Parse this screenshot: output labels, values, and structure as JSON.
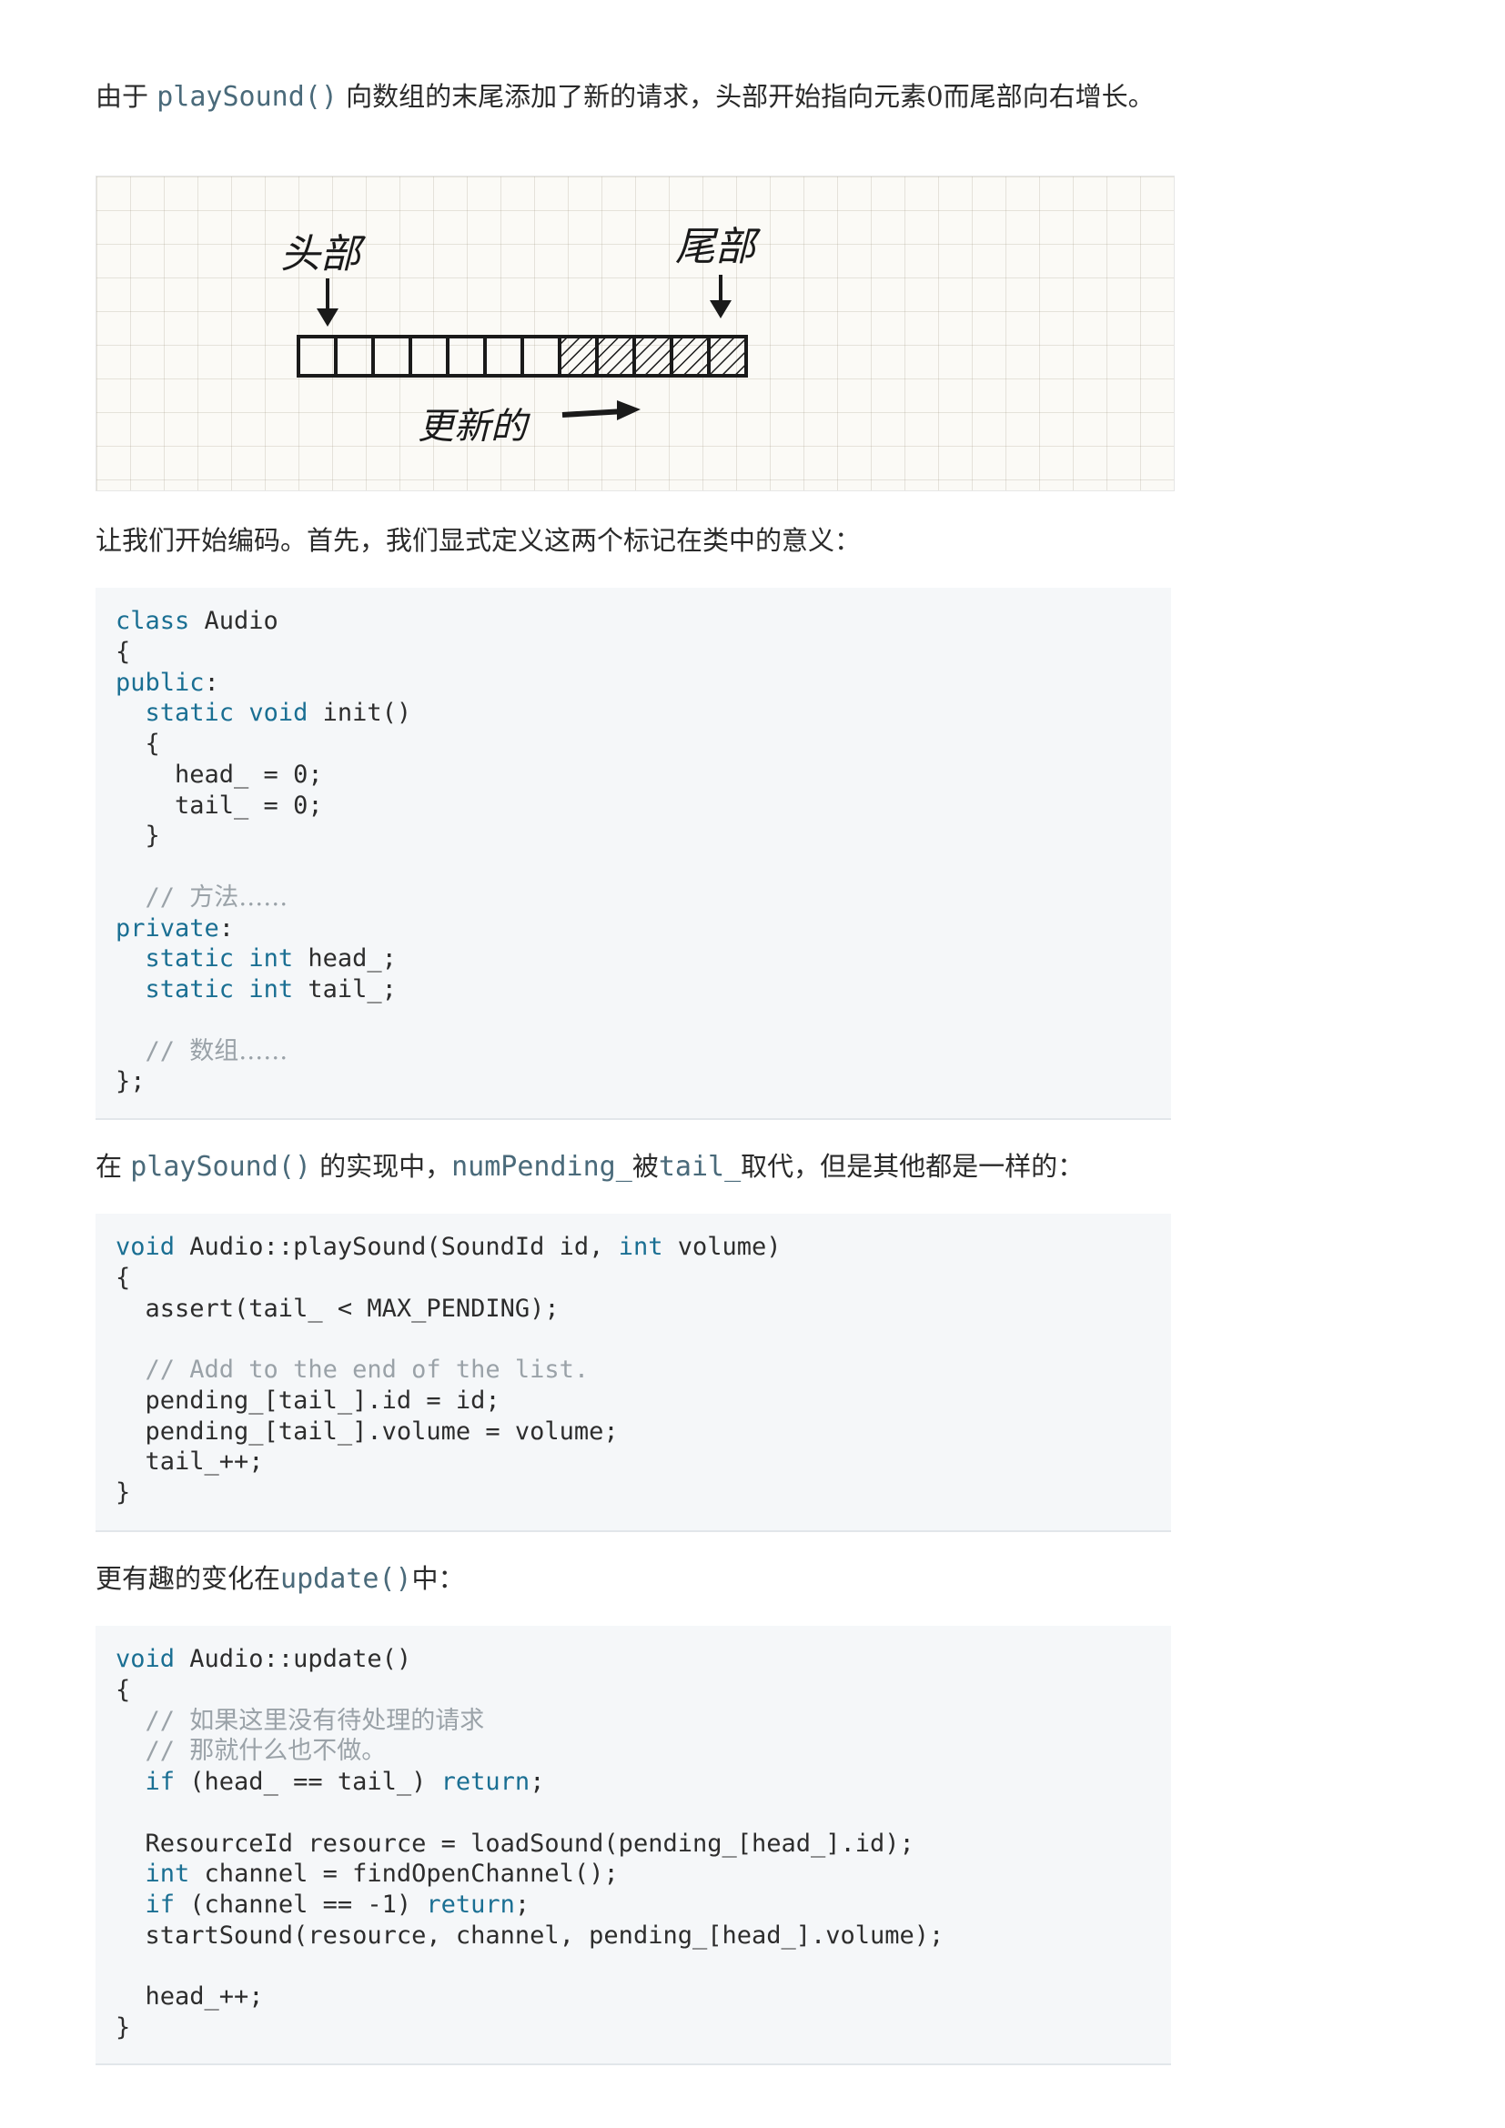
{
  "paragraphs": {
    "p1": [
      {
        "t": "由于 ",
        "k": "text"
      },
      {
        "t": "playSound()",
        "k": "code"
      },
      {
        "t": " 向数组的末尾添加了新的请求，头部开始指向元素0而尾部向右增长。",
        "k": "text"
      }
    ],
    "p2": [
      {
        "t": "让我们开始编码。首先，我们显式定义这两个标记在类中的意义：",
        "k": "text"
      }
    ],
    "p3": [
      {
        "t": "在 ",
        "k": "text"
      },
      {
        "t": "playSound()",
        "k": "code"
      },
      {
        "t": " 的实现中，",
        "k": "text"
      },
      {
        "t": "numPending_",
        "k": "code"
      },
      {
        "t": "被",
        "k": "text"
      },
      {
        "t": "tail_",
        "k": "code"
      },
      {
        "t": "取代，但是其他都是一样的：",
        "k": "text"
      }
    ],
    "p4": [
      {
        "t": "更有趣的变化在",
        "k": "text"
      },
      {
        "t": "update()",
        "k": "code"
      },
      {
        "t": "中：",
        "k": "text"
      }
    ]
  },
  "figure": {
    "head_label": "头部",
    "tail_label": "尾部",
    "newer_label": "更新的",
    "cell_count": 12,
    "empty_cells": 7,
    "filled_cells": 5
  },
  "code_blocks": {
    "audio_class": [
      [
        [
          "class",
          "kw"
        ],
        [
          " Audio",
          ""
        ]
      ],
      [
        [
          "{",
          ""
        ]
      ],
      [
        [
          "public",
          "kw"
        ],
        [
          ":",
          ""
        ]
      ],
      [
        [
          "  ",
          ""
        ],
        [
          "static",
          "kw"
        ],
        [
          " ",
          ""
        ],
        [
          "void",
          "kw"
        ],
        [
          " init()",
          ""
        ]
      ],
      [
        [
          "  {",
          ""
        ]
      ],
      [
        [
          "    head_ = 0;",
          ""
        ]
      ],
      [
        [
          "    tail_ = 0;",
          ""
        ]
      ],
      [
        [
          "  }",
          ""
        ]
      ],
      [
        [
          "",
          ""
        ]
      ],
      [
        [
          "  ",
          ""
        ],
        [
          "// ",
          "cm"
        ],
        [
          "方法……",
          "cmcn"
        ]
      ],
      [
        [
          "private",
          "kw"
        ],
        [
          ":",
          ""
        ]
      ],
      [
        [
          "  ",
          ""
        ],
        [
          "static",
          "kw"
        ],
        [
          " ",
          ""
        ],
        [
          "int",
          "kw"
        ],
        [
          " head_;",
          ""
        ]
      ],
      [
        [
          "  ",
          ""
        ],
        [
          "static",
          "kw"
        ],
        [
          " ",
          ""
        ],
        [
          "int",
          "kw"
        ],
        [
          " tail_;",
          ""
        ]
      ],
      [
        [
          "",
          ""
        ]
      ],
      [
        [
          "  ",
          ""
        ],
        [
          "// ",
          "cm"
        ],
        [
          "数组……",
          "cmcn"
        ]
      ],
      [
        [
          "};",
          ""
        ]
      ]
    ],
    "play_sound": [
      [
        [
          "void",
          "kw"
        ],
        [
          " Audio::playSound(SoundId id, ",
          ""
        ],
        [
          "int",
          "kw"
        ],
        [
          " volume)",
          ""
        ]
      ],
      [
        [
          "{",
          ""
        ]
      ],
      [
        [
          "  assert(tail_ < MAX_PENDING);",
          ""
        ]
      ],
      [
        [
          "",
          ""
        ]
      ],
      [
        [
          "  ",
          ""
        ],
        [
          "// Add to the end of the list.",
          "cm"
        ]
      ],
      [
        [
          "  pending_[tail_].id = id;",
          ""
        ]
      ],
      [
        [
          "  pending_[tail_].volume = volume;",
          ""
        ]
      ],
      [
        [
          "  tail_++;",
          ""
        ]
      ],
      [
        [
          "}",
          ""
        ]
      ]
    ],
    "update": [
      [
        [
          "void",
          "kw"
        ],
        [
          " Audio::update()",
          ""
        ]
      ],
      [
        [
          "{",
          ""
        ]
      ],
      [
        [
          "  ",
          ""
        ],
        [
          "// ",
          "cm"
        ],
        [
          "如果这里没有待处理的请求",
          "cmcn"
        ]
      ],
      [
        [
          "  ",
          ""
        ],
        [
          "// ",
          "cm"
        ],
        [
          "那就什么也不做。",
          "cmcn"
        ]
      ],
      [
        [
          "  ",
          ""
        ],
        [
          "if",
          "kw"
        ],
        [
          " (head_ == tail_) ",
          ""
        ],
        [
          "return",
          "kw"
        ],
        [
          ";",
          ""
        ]
      ],
      [
        [
          "",
          ""
        ]
      ],
      [
        [
          "  ResourceId resource = loadSound(pending_[head_].id);",
          ""
        ]
      ],
      [
        [
          "  ",
          ""
        ],
        [
          "int",
          "kw"
        ],
        [
          " channel = findOpenChannel();",
          ""
        ]
      ],
      [
        [
          "  ",
          ""
        ],
        [
          "if",
          "kw"
        ],
        [
          " (channel == -1) ",
          ""
        ],
        [
          "return",
          "kw"
        ],
        [
          ";",
          ""
        ]
      ],
      [
        [
          "  startSound(resource, channel, pending_[head_].volume);",
          ""
        ]
      ],
      [
        [
          "",
          ""
        ]
      ],
      [
        [
          "  head_++;",
          ""
        ]
      ],
      [
        [
          "}",
          ""
        ]
      ]
    ]
  }
}
